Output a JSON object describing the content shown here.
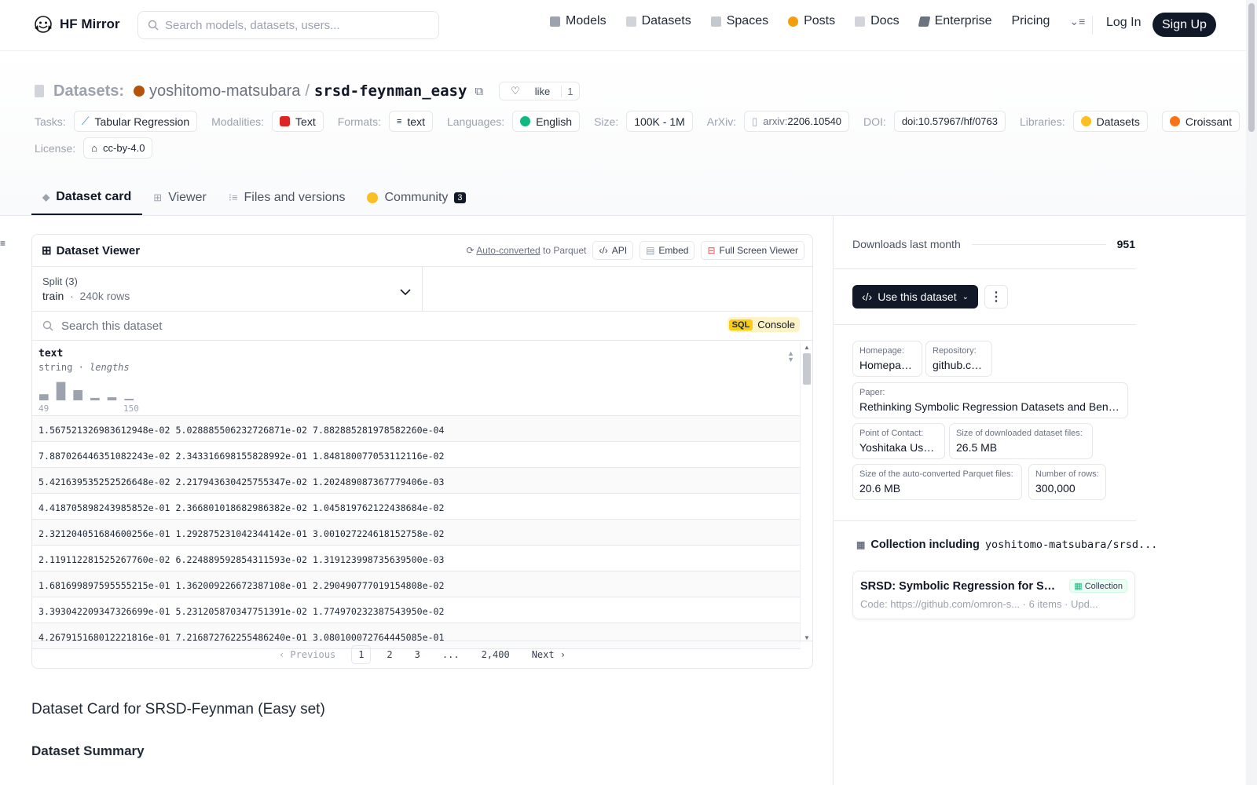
{
  "header": {
    "logo_text": "HF Mirror",
    "search_placeholder": "Search models, datasets, users...",
    "nav": [
      {
        "label": "Models",
        "color": "#9ca3af"
      },
      {
        "label": "Datasets",
        "color": "#9ca3af"
      },
      {
        "label": "Spaces",
        "color": "#9ca3af"
      },
      {
        "label": "Posts",
        "color": "#f59e0b"
      },
      {
        "label": "Docs",
        "color": "#9ca3af"
      },
      {
        "label": "Enterprise",
        "color": "#6b7280"
      },
      {
        "label": "Pricing"
      }
    ],
    "login": "Log In",
    "signup": "Sign Up"
  },
  "repo": {
    "kind_label": "Datasets:",
    "owner": "yoshitomo-matsubara",
    "slash": "/",
    "name": "srsd-feynman_easy",
    "like_label": "like",
    "like_count": "1"
  },
  "tags": {
    "tasks_label": "Tasks:",
    "task": "Tabular Regression",
    "modalities_label": "Modalities:",
    "modality": "Text",
    "formats_label": "Formats:",
    "format": "text",
    "languages_label": "Languages:",
    "language": "English",
    "size_label": "Size:",
    "size": "100K - 1M",
    "arxiv_label": "ArXiv:",
    "arxiv_prefix": "arxiv:",
    "arxiv_id": "2206.10540",
    "doi_label": "DOI:",
    "doi": "doi:10.57967/hf/0763",
    "libraries_label": "Libraries:",
    "lib1": "Datasets",
    "lib2": "Croissant",
    "license_label": "License:",
    "license": "cc-by-4.0"
  },
  "tabs": [
    {
      "label": "Dataset card"
    },
    {
      "label": "Viewer"
    },
    {
      "label": "Files and versions"
    },
    {
      "label": "Community",
      "badge": "3"
    }
  ],
  "viewer": {
    "title": "Dataset Viewer",
    "autoconv_link": "Auto-converted",
    "autoconv_rest": " to Parquet",
    "api": "API",
    "embed": "Embed",
    "fullscreen": "Full Screen Viewer",
    "split_label": "Split (3)",
    "split_name": "train",
    "split_rows": "240k rows",
    "search_placeholder": "Search this dataset",
    "sql_tag": "SQL",
    "sql_label": "Console",
    "column": {
      "name": "text",
      "type": "string",
      "sub": "lengths",
      "min": "49",
      "max": "150",
      "histogram": [
        0.3,
        0.9,
        0.5,
        0.12,
        0.15,
        0.06
      ]
    },
    "rows": [
      "1.567521326983612948e-02 5.028885506232726871e-02 7.882885281978582260e-04",
      "7.887026446351082243e-02 2.343316698155828992e-01 1.848180077053112116e-02",
      "5.421639535252526648e-02 2.217943630425755347e-02 1.202489087367779406e-03",
      "4.418705898243985852e-01 2.366801018682986382e-02 1.045819762122438684e-02",
      "2.321204051684600256e-01 1.292875231042344142e-01 3.001027224618152758e-02",
      "2.119112281525267760e-02 6.224889592854311593e-02 1.319123998735639500e-03",
      "1.681699897595555215e-01 1.362009226672387108e-01 2.290490777019154808e-02",
      "3.393042209347326699e-01 5.231205870347751391e-02 1.774970232387543950e-02",
      "4.267915168012221816e-01 7.216872762255486240e-01 3.080100072764445085e-01"
    ],
    "pager": {
      "prev": "Previous",
      "p1": "1",
      "p2": "2",
      "p3": "3",
      "ellipsis": "...",
      "last": "2,400",
      "next": "Next"
    }
  },
  "card": {
    "title": "Dataset Card for SRSD-Feynman (Easy set)",
    "summary": "Dataset Summary"
  },
  "sidebar": {
    "downloads_label": "Downloads last month",
    "downloads": "951",
    "use_button": "Use this dataset",
    "meta": [
      {
        "k": "Homepage:",
        "v": "Homepage:"
      },
      {
        "k": "Repository:",
        "v": "github.com"
      },
      {
        "k": "Paper:",
        "v": "Rethinking Symbolic Regression Datasets and Benchmarks..."
      },
      {
        "k": "Point of Contact:",
        "v": "Yoshitaka Ushiku"
      },
      {
        "k": "Size of downloaded dataset files:",
        "v": "26.5 MB"
      },
      {
        "k": "Size of the auto-converted Parquet files:",
        "v": "20.6 MB"
      },
      {
        "k": "Number of rows:",
        "v": "300,000"
      }
    ],
    "collection_label": "Collection including",
    "collection_repo": "yoshitomo-matsubara/srsd...",
    "collection_title": "SRSD: Symbolic Regression for Scientific Discovery",
    "collection_tag": "Collection",
    "collection_sub": "Code: https://github.com/omron-s...  ·  6 items  ·  Upd..."
  }
}
